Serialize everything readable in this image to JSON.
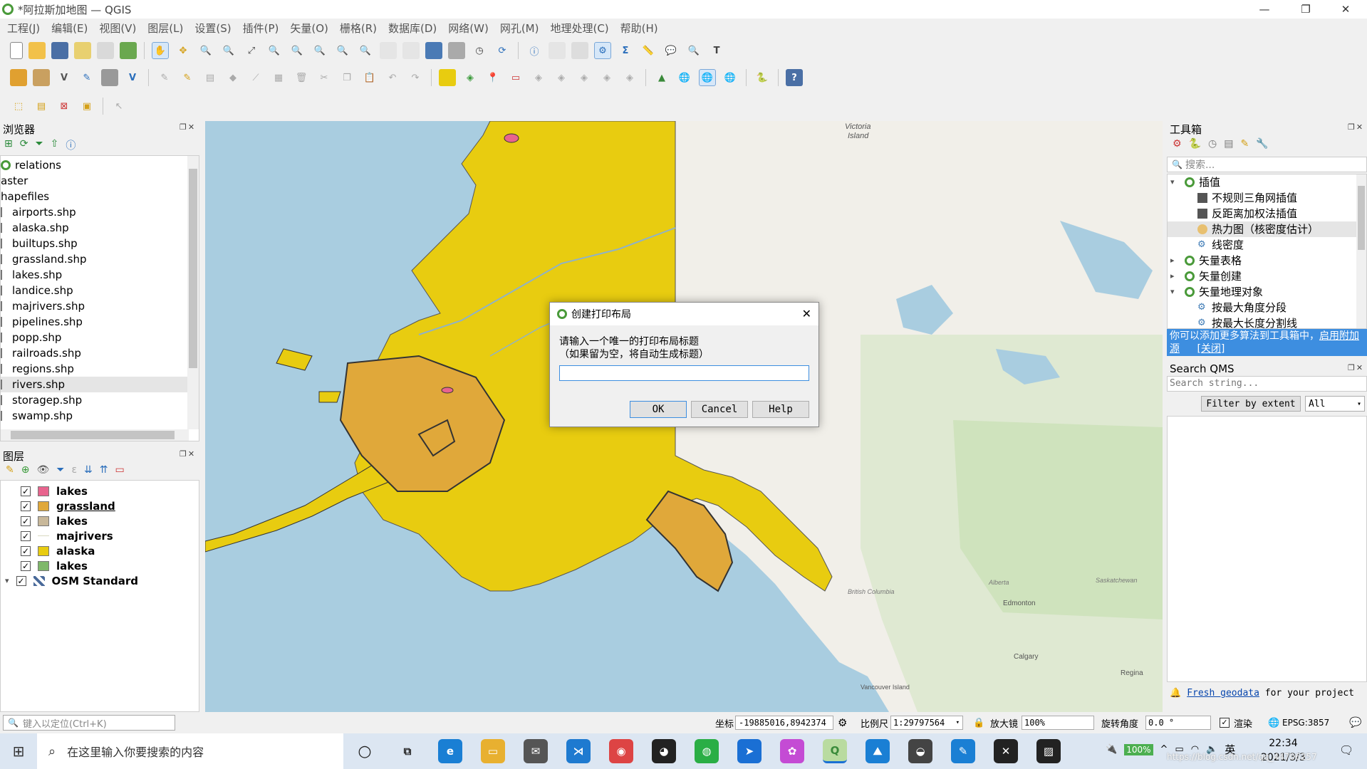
{
  "window": {
    "title": "*阿拉斯加地图 — QGIS",
    "minimize": "—",
    "restore": "❐",
    "close": "✕"
  },
  "menu": [
    "工程(J)",
    "编辑(E)",
    "视图(V)",
    "图层(L)",
    "设置(S)",
    "插件(P)",
    "矢量(O)",
    "栅格(R)",
    "数据库(D)",
    "网络(W)",
    "网孔(M)",
    "地理处理(C)",
    "帮助(H)"
  ],
  "browser": {
    "title": "浏览器",
    "items": [
      "relations",
      "aster",
      "hapefiles",
      "airports.shp",
      "alaska.shp",
      "builtups.shp",
      "grassland.shp",
      "lakes.shp",
      "landice.shp",
      "majrivers.shp",
      "pipelines.shp",
      "popp.shp",
      "railroads.shp",
      "regions.shp",
      "rivers.shp",
      "storagep.shp",
      "swamp.shp"
    ]
  },
  "layers": {
    "title": "图层",
    "items": [
      {
        "name": "lakes",
        "color": "#e8648e"
      },
      {
        "name": "grassland",
        "color": "#e0a83a"
      },
      {
        "name": "lakes",
        "color": "#c8b89a"
      },
      {
        "name": "majrivers",
        "color": "#d9d9c0"
      },
      {
        "name": "alaska",
        "color": "#e8cc10"
      },
      {
        "name": "lakes",
        "color": "#7fb86a"
      },
      {
        "name": "OSM Standard",
        "color": "#4a6a9a"
      }
    ]
  },
  "locator": {
    "placeholder": "键入以定位(Ctrl+K)"
  },
  "toolbox": {
    "title": "工具箱",
    "search_placeholder": "搜索...",
    "tree": [
      {
        "label": "插值",
        "level": 0,
        "expand": "▾"
      },
      {
        "label": "不规则三角网插值",
        "level": 1
      },
      {
        "label": "反距离加权法插值",
        "level": 1
      },
      {
        "label": "热力图（核密度估计）",
        "level": 1
      },
      {
        "label": "线密度",
        "level": 1
      },
      {
        "label": "矢量表格",
        "level": 0,
        "expand": "▸"
      },
      {
        "label": "矢量创建",
        "level": 0,
        "expand": "▸"
      },
      {
        "label": "矢量地理对象",
        "level": 0,
        "expand": "▾"
      },
      {
        "label": "按最大角度分段",
        "level": 1
      },
      {
        "label": "按最大长度分割线",
        "level": 1
      }
    ],
    "notice_text": "你可以添加更多算法到工具箱中，",
    "notice_link": "启用附加源",
    "notice_close": "[关闭]"
  },
  "qms": {
    "title": "Search QMS",
    "placeholder": "Search string...",
    "filter_button": "Filter by extent",
    "filter_select": "All",
    "footer_link": "Fresh geodata",
    "footer_text": " for your project"
  },
  "dialog": {
    "title": "创建打印布局",
    "prompt_line1": "请输入一个唯一的打印布局标题",
    "prompt_line2": "（如果留为空，将自动生成标题）",
    "input_value": "",
    "ok": "OK",
    "cancel": "Cancel",
    "help": "Help"
  },
  "map_labels": {
    "victoria": "Victoria\nIsland",
    "edmonton": "Edmonton",
    "calgary": "Calgary",
    "regina": "Regina",
    "alberta": "Alberta",
    "bc": "British Columbia",
    "sask": "Saskatchewan",
    "vancouver": "Vancouver\nIsland"
  },
  "statusbar": {
    "coord_label": "坐标",
    "coord_value": "-19885016,8942374",
    "scale_label": "比例尺",
    "scale_value": "1:29797564",
    "magnifier_label": "放大镜",
    "magnifier_value": "100%",
    "rotation_label": "旋转角度",
    "rotation_value": "0.0 °",
    "render_label": "渲染",
    "epsg": "EPSG:3857"
  },
  "taskbar": {
    "search_placeholder": "在这里输入你要搜索的内容",
    "battery": "100%",
    "ime": "英",
    "time": "22:34",
    "date": "2021/3/3",
    "watermark": "https://blog.csdn.net/qq_44706257"
  }
}
